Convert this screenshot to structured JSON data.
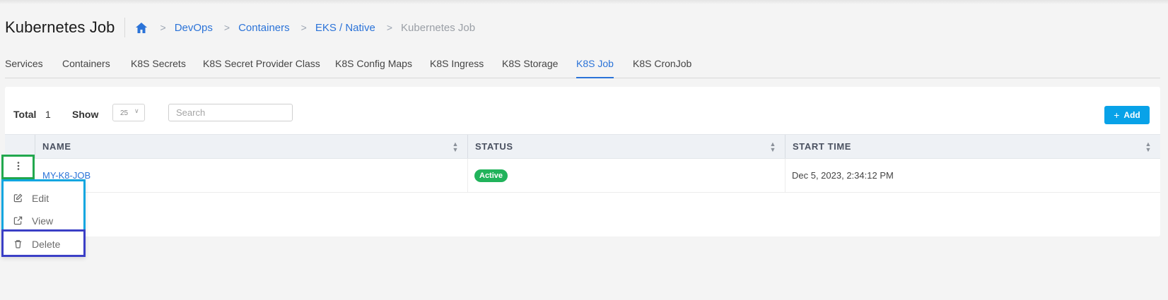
{
  "page": {
    "title": "Kubernetes Job"
  },
  "breadcrumb": [
    {
      "label": "DevOps"
    },
    {
      "label": "Containers"
    },
    {
      "label": "EKS / Native"
    },
    {
      "label": "Kubernetes Job"
    }
  ],
  "breadcrumb_separator": ">",
  "tabs": [
    {
      "label": "Services"
    },
    {
      "label": "Containers"
    },
    {
      "label": "K8S Secrets"
    },
    {
      "label": "K8S Secret Provider Class"
    },
    {
      "label": "K8S Config Maps"
    },
    {
      "label": "K8S Ingress"
    },
    {
      "label": "K8S Storage"
    },
    {
      "label": "K8S Job",
      "active": true
    },
    {
      "label": "K8S CronJob"
    }
  ],
  "toolbar": {
    "total_label": "Total",
    "total_value": "1",
    "show_label": "Show",
    "page_size": "25",
    "search_placeholder": "Search",
    "add_label": "Add",
    "add_icon": "plus-icon"
  },
  "table": {
    "columns": [
      {
        "label": "NAME"
      },
      {
        "label": "STATUS"
      },
      {
        "label": "START TIME"
      }
    ],
    "rows": [
      {
        "name": "MY-K8-JOB",
        "status": "Active",
        "start_time": "Dec 5, 2023, 2:34:12 PM"
      }
    ]
  },
  "action_menu": {
    "trigger_icon": "kebab-vertical-icon",
    "items": [
      {
        "label": "Edit",
        "icon": "edit-icon"
      },
      {
        "label": "View",
        "icon": "external-link-icon"
      },
      {
        "label": "Delete",
        "icon": "trash-icon"
      }
    ]
  },
  "colors": {
    "accent": "#2b73d8",
    "add_button": "#08a2e8",
    "status_active": "#21b35b",
    "highlight_green": "#22a84e",
    "highlight_cyan": "#10a6e0",
    "highlight_indigo": "#3b3fc6"
  }
}
